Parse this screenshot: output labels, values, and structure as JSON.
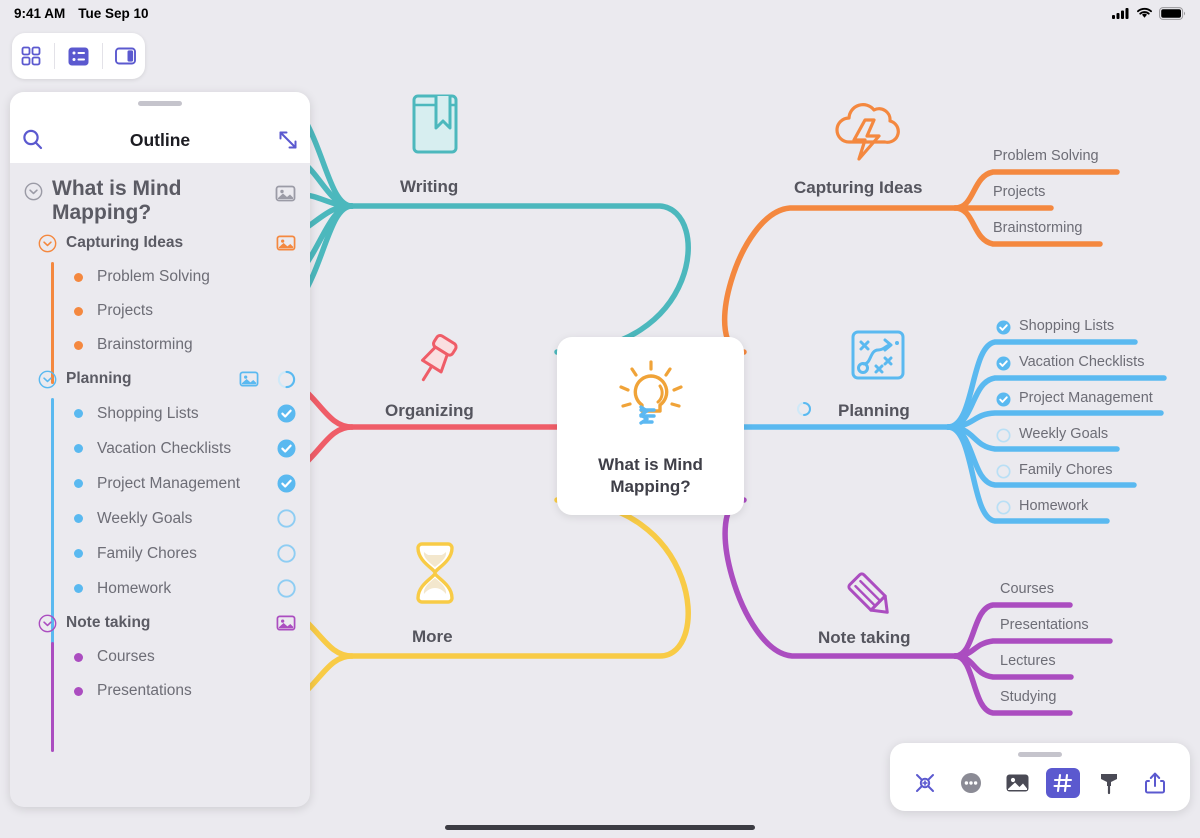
{
  "status_bar": {
    "time": "9:41 AM",
    "date": "Tue Sep 10",
    "icons": [
      "cellular-signal-icon",
      "wifi-icon",
      "battery-icon"
    ]
  },
  "view_toolbar": {
    "buttons": [
      {
        "name": "grid-view-button",
        "icon": "grid-icon",
        "active": false
      },
      {
        "name": "outline-view-button",
        "icon": "list-icon",
        "active": true
      },
      {
        "name": "split-view-button",
        "icon": "split-panel-icon",
        "active": false
      }
    ]
  },
  "outline_panel": {
    "title": "Outline",
    "search_icon": "search-icon",
    "expand_icon": "expand-arrows-icon",
    "root": {
      "label": "What is Mind Mapping?",
      "color": "#8e8e98",
      "has_image": true
    },
    "groups": [
      {
        "label": "Capturing Ideas",
        "color": "#f4883f",
        "has_image": true,
        "progress": null,
        "items": [
          {
            "label": "Problem Solving",
            "checkbox": null
          },
          {
            "label": "Projects",
            "checkbox": null
          },
          {
            "label": "Brainstorming",
            "checkbox": null
          }
        ]
      },
      {
        "label": "Planning",
        "color": "#5ab9f0",
        "has_image": true,
        "progress": 50,
        "items": [
          {
            "label": "Shopping Lists",
            "checkbox": "checked"
          },
          {
            "label": "Vacation Checklists",
            "checkbox": "checked"
          },
          {
            "label": "Project Management",
            "checkbox": "checked"
          },
          {
            "label": "Weekly Goals",
            "checkbox": "unchecked"
          },
          {
            "label": "Family Chores",
            "checkbox": "unchecked"
          },
          {
            "label": "Homework",
            "checkbox": "unchecked"
          }
        ]
      },
      {
        "label": "Note taking",
        "color": "#b martialarts",
        "has_image": true,
        "progress": null,
        "items": [
          {
            "label": "Courses",
            "checkbox": null
          },
          {
            "label": "Presentations",
            "checkbox": null
          }
        ]
      }
    ]
  },
  "mindmap": {
    "center": {
      "title": "What is Mind Mapping?",
      "icon": "lightbulb-icon"
    },
    "branches": [
      {
        "label": "Writing",
        "color": "#4cb8bd",
        "icon": "book-bookmark-icon",
        "side": "left",
        "children": []
      },
      {
        "label": "Organizing",
        "color": "#ef5d68",
        "icon": "pushpin-icon",
        "side": "left",
        "children": []
      },
      {
        "label": "More",
        "color": "#f8cb46",
        "icon": "hourglass-icon",
        "side": "left",
        "children": []
      },
      {
        "label": "Capturing Ideas",
        "color": "#f4883f",
        "icon": "brainstorm-cloud-icon",
        "side": "right",
        "children": [
          {
            "label": "Problem Solving",
            "checkbox": null
          },
          {
            "label": "Projects",
            "checkbox": null
          },
          {
            "label": "Brainstorming",
            "checkbox": null
          }
        ]
      },
      {
        "label": "Planning",
        "color": "#5ab9f0",
        "icon": "strategy-board-icon",
        "side": "right",
        "progress": 50,
        "children": [
          {
            "label": "Shopping Lists",
            "checkbox": "checked"
          },
          {
            "label": "Vacation Checklists",
            "checkbox": "checked"
          },
          {
            "label": "Project Management",
            "checkbox": "checked"
          },
          {
            "label": "Weekly Goals",
            "checkbox": "unchecked"
          },
          {
            "label": "Family Chores",
            "checkbox": "unchecked"
          },
          {
            "label": "Homework",
            "checkbox": "unchecked"
          }
        ]
      },
      {
        "label": "Note taking",
        "color": "#ab4dc0",
        "icon": "pencil-icon",
        "side": "right",
        "children": [
          {
            "label": "Courses",
            "checkbox": null
          },
          {
            "label": "Presentations",
            "checkbox": null
          },
          {
            "label": "Lectures",
            "checkbox": null
          },
          {
            "label": "Studying",
            "checkbox": null
          }
        ]
      }
    ]
  },
  "bottom_toolbar": {
    "buttons": [
      {
        "name": "add-node-button",
        "icon": "node-connect-icon",
        "active": false
      },
      {
        "name": "more-options-button",
        "icon": "ellipsis-circle-icon",
        "active": false
      },
      {
        "name": "insert-image-button",
        "icon": "image-icon",
        "active": false
      },
      {
        "name": "tags-button",
        "icon": "hashtag-icon",
        "active": true
      },
      {
        "name": "style-brush-button",
        "icon": "brush-icon",
        "active": false
      },
      {
        "name": "share-button",
        "icon": "share-icon",
        "active": false
      }
    ]
  }
}
